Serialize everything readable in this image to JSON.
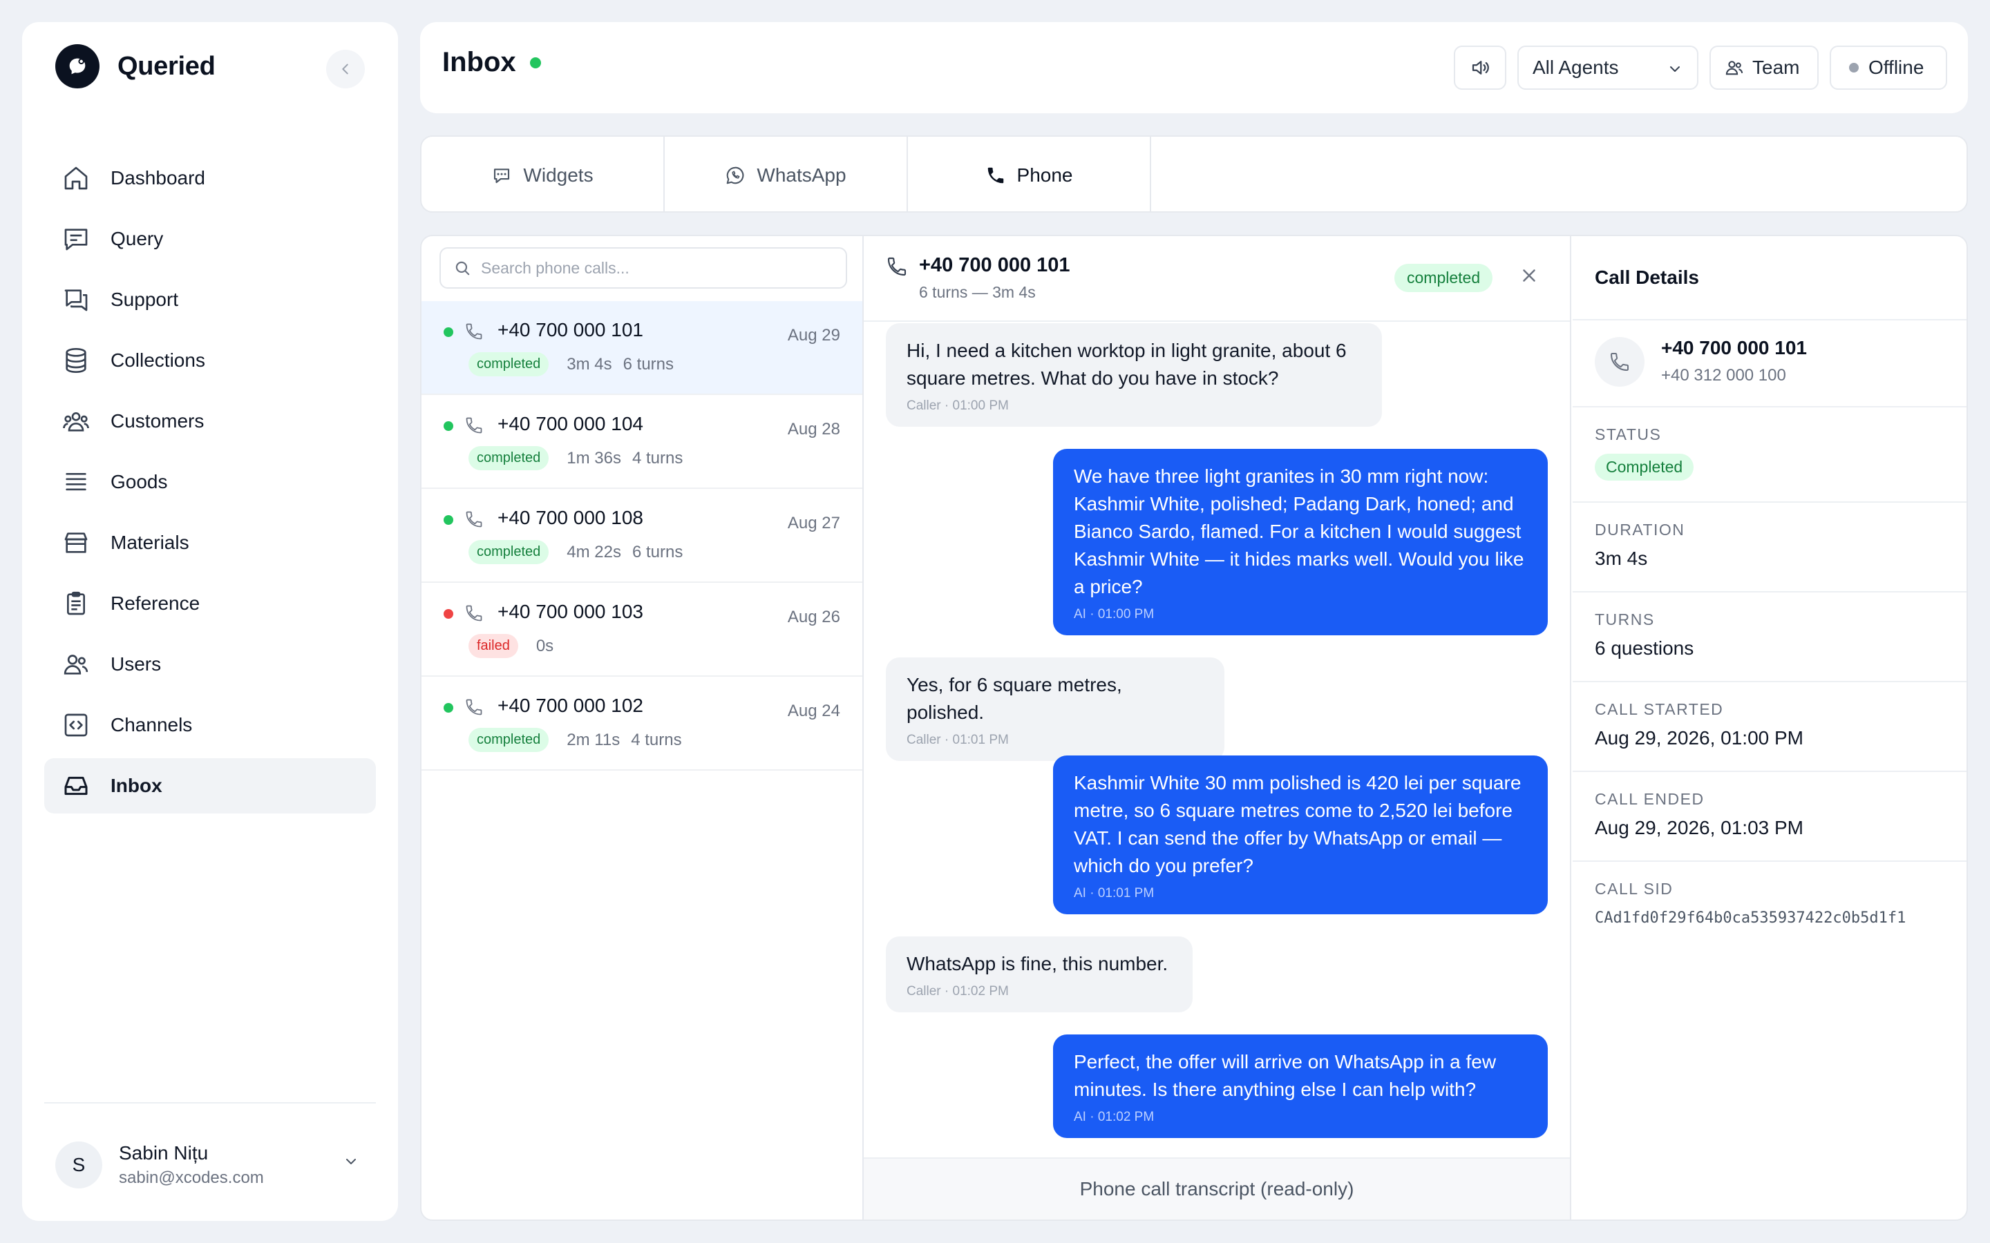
{
  "sidebar": {
    "brand": "Queried",
    "items": [
      {
        "label": "Dashboard",
        "icon": "home-icon"
      },
      {
        "label": "Query",
        "icon": "message-square-icon"
      },
      {
        "label": "Support",
        "icon": "messages-icon"
      },
      {
        "label": "Collections",
        "icon": "database-icon"
      },
      {
        "label": "Customers",
        "icon": "customers-icon"
      },
      {
        "label": "Goods",
        "icon": "list-icon"
      },
      {
        "label": "Materials",
        "icon": "box-icon"
      },
      {
        "label": "Reference",
        "icon": "clipboard-icon"
      },
      {
        "label": "Users",
        "icon": "users-icon"
      },
      {
        "label": "Channels",
        "icon": "code-icon"
      },
      {
        "label": "Inbox",
        "icon": "inbox-icon",
        "active": true
      }
    ],
    "user": {
      "initial": "S",
      "name": "Sabin Nițu",
      "email": "sabin@xcodes.com"
    }
  },
  "header": {
    "title": "Inbox",
    "agents_select": "All Agents",
    "team_label": "Team",
    "status_label": "Offline"
  },
  "tabs": [
    {
      "label": "Widgets",
      "icon": "chat-bubble-icon"
    },
    {
      "label": "WhatsApp",
      "icon": "whatsapp-icon"
    },
    {
      "label": "Phone",
      "icon": "phone-icon",
      "active": true
    }
  ],
  "call_list": {
    "search_placeholder": "Search phone calls...",
    "calls": [
      {
        "number": "+40 700 000 101",
        "date": "Aug 29",
        "status": "completed",
        "duration": "3m 4s",
        "turns": "6 turns",
        "selected": true
      },
      {
        "number": "+40 700 000 104",
        "date": "Aug 28",
        "status": "completed",
        "duration": "1m 36s",
        "turns": "4 turns"
      },
      {
        "number": "+40 700 000 108",
        "date": "Aug 27",
        "status": "completed",
        "duration": "4m 22s",
        "turns": "6 turns"
      },
      {
        "number": "+40 700 000 103",
        "date": "Aug 26",
        "status": "failed",
        "duration": "0s",
        "turns": ""
      },
      {
        "number": "+40 700 000 102",
        "date": "Aug 24",
        "status": "completed",
        "duration": "2m 11s",
        "turns": "4 turns"
      }
    ]
  },
  "conversation": {
    "number": "+40 700 000 101",
    "subtitle": "6 turns — 3m 4s",
    "status": "completed",
    "messages": [
      {
        "role": "caller",
        "lines": [
          "Hi, I need a kitchen worktop in light granite, about 6",
          "square metres. What do you have in stock?"
        ],
        "time": "Caller · 01:00 PM"
      },
      {
        "role": "ai",
        "lines": [
          "We have three light granites in 30 mm right now:",
          "Kashmir White, polished; Padang Dark, honed; and",
          "Bianco Sardo, flamed. For a kitchen I would suggest",
          "Kashmir White — it hides marks well. Would you like",
          "a price?"
        ],
        "time": "AI · 01:00 PM"
      },
      {
        "role": "caller",
        "lines": [
          "Yes, for 6 square metres, polished."
        ],
        "time": "Caller · 01:01 PM"
      },
      {
        "role": "ai",
        "lines": [
          "Kashmir White 30 mm polished is 420 lei per square",
          "metre, so 6 square metres come to 2,520 lei before",
          "VAT. I can send the offer by WhatsApp or email —",
          "which do you prefer?"
        ],
        "time": "AI · 01:01 PM"
      },
      {
        "role": "caller",
        "lines": [
          "WhatsApp is fine, this number."
        ],
        "time": "Caller · 01:02 PM"
      },
      {
        "role": "ai",
        "lines": [
          "Perfect, the offer will arrive on WhatsApp in a few",
          "minutes. Is there anything else I can help with?"
        ],
        "time": "AI · 01:02 PM"
      }
    ],
    "footer": "Phone call transcript (read-only)"
  },
  "details": {
    "title": "Call Details",
    "number": "+40 700 000 101",
    "secondary_number": "+40 312 000 100",
    "status_label": "STATUS",
    "status_value": "Completed",
    "duration_label": "DURATION",
    "duration_value": "3m 4s",
    "turns_label": "TURNS",
    "turns_value": "6 questions",
    "started_label": "CALL STARTED",
    "started_value": "Aug 29, 2026, 01:00 PM",
    "ended_label": "CALL ENDED",
    "ended_value": "Aug 29, 2026, 01:03 PM",
    "sid_label": "CALL SID",
    "sid_value": "CAd1fd0f29f64b0ca535937422c0b5d1f1"
  },
  "colors": {
    "accent_blue": "#1a5cf5",
    "online_green": "#22c55e",
    "failed_red": "#ef4444",
    "completed_badge_bg": "#dcfce7"
  }
}
